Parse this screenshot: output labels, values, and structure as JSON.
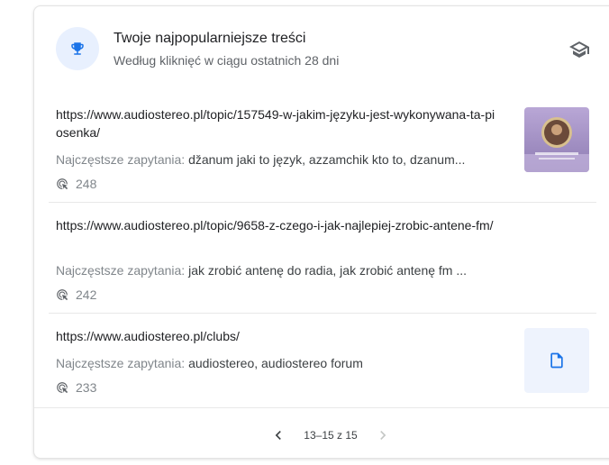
{
  "header": {
    "title": "Twoje najpopularniejsze treści",
    "subtitle": "Według kliknięć w ciągu ostatnich 28 dni",
    "icon": "trophy-icon",
    "action_icon": "graduation-cap-icon"
  },
  "items": [
    {
      "url": "https://www.audiostereo.pl/topic/157549-w-jakim-języku-jest-wykonywana-ta-piosenka/",
      "queries_label": "Najczęstsze zapytania:",
      "queries": " džanum jaki to język, azzamchik kto to, dzanum...",
      "clicks": "248",
      "thumbnail": "image"
    },
    {
      "url": "https://www.audiostereo.pl/topic/9658-z-czego-i-jak-najlepiej-zrobic-antene-fm/",
      "queries_label": "Najczęstsze zapytania:",
      "queries": " jak zrobić antenę do radia, jak zrobić antenę fm ...",
      "clicks": "242",
      "thumbnail": "none"
    },
    {
      "url": "https://www.audiostereo.pl/clubs/",
      "queries_label": "Najczęstsze zapytania:",
      "queries": " audiostereo, audiostereo forum",
      "clicks": "233",
      "thumbnail": "document"
    }
  ],
  "pagination": {
    "range": "13–15 z 15"
  },
  "colors": {
    "accent": "#1a73e8",
    "icon_bg": "#e8f0fe",
    "muted": "#80868b"
  }
}
